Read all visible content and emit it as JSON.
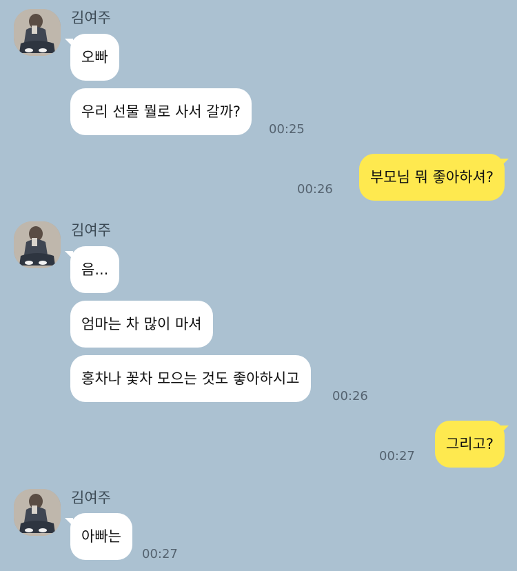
{
  "colors": {
    "background": "#abc1d1",
    "incoming_bubble": "#ffffff",
    "outgoing_bubble": "#fee94f"
  },
  "sender": {
    "name": "김여주",
    "avatar_icon": "profile-photo"
  },
  "messages": [
    {
      "from": "other",
      "text": "오빠"
    },
    {
      "from": "other",
      "text": "우리 선물 뭘로 사서 갈까?",
      "time": "00:25"
    },
    {
      "from": "me",
      "text": "부모님 뭐 좋아하셔?",
      "time": "00:26"
    },
    {
      "from": "other",
      "text": "음..."
    },
    {
      "from": "other",
      "text": "엄마는 차 많이 마셔"
    },
    {
      "from": "other",
      "text": "홍차나 꽃차 모으는 것도 좋아하시고",
      "time": "00:26"
    },
    {
      "from": "me",
      "text": "그리고?",
      "time": "00:27"
    },
    {
      "from": "other",
      "text": "아빠는",
      "time": "00:27"
    }
  ]
}
